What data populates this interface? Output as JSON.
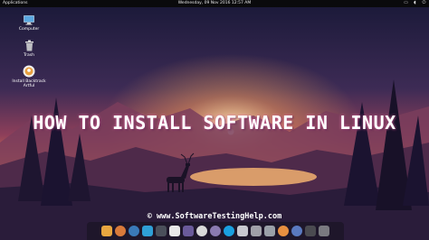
{
  "topbar": {
    "apps_label": "Applications",
    "clock": "Wednesday, 09 Nov 2016 12:57 AM",
    "tray_icons": [
      "window-icon",
      "volume-icon",
      "power-icon"
    ]
  },
  "desktop_icons": [
    {
      "label": "Computer",
      "icon": "computer-icon"
    },
    {
      "label": "Trash",
      "icon": "trash-icon"
    },
    {
      "label": "Install Backtrack Artful",
      "icon": "installer-icon"
    }
  ],
  "headline": "HOW TO INSTALL SOFTWARE IN LINUX",
  "website": "© www.SoftwareTestingHelp.com",
  "dock": {
    "items": [
      {
        "name": "files-icon",
        "color": "#e8a640"
      },
      {
        "name": "browser-icon",
        "color": "#d97a3a"
      },
      {
        "name": "system-icon",
        "color": "#3a7ab8"
      },
      {
        "name": "settings-icon",
        "color": "#2f9fd6"
      },
      {
        "name": "calculator-icon",
        "color": "#4a4f5a"
      },
      {
        "name": "calendar-icon",
        "color": "#e8e8e8"
      },
      {
        "name": "app-icon",
        "color": "#6a5a9a"
      },
      {
        "name": "chrome-icon",
        "color": "#d9d9d9"
      },
      {
        "name": "photos-icon",
        "color": "#8a7ab0"
      },
      {
        "name": "skype-icon",
        "color": "#1aa0e0"
      },
      {
        "name": "media-icon",
        "color": "#c8c8d0"
      },
      {
        "name": "store-icon",
        "color": "#a0a0a8"
      },
      {
        "name": "mail-icon",
        "color": "#9aa0a8"
      },
      {
        "name": "appstore-icon",
        "color": "#e89040"
      },
      {
        "name": "bluetooth-icon",
        "color": "#5a7ac0"
      },
      {
        "name": "terminal-icon",
        "color": "#4a4a50"
      },
      {
        "name": "trash-dock-icon",
        "color": "#7a7a80"
      }
    ]
  }
}
